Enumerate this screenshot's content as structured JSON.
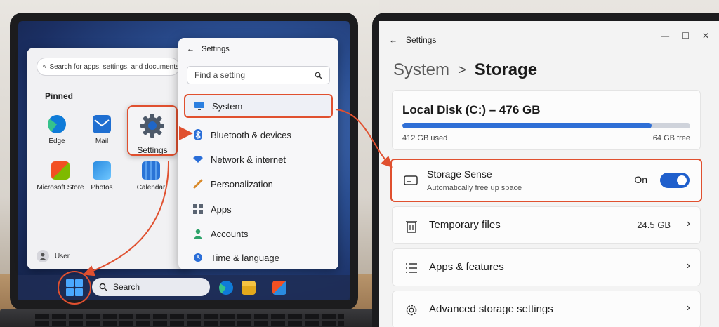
{
  "start_menu": {
    "search_placeholder": "Search for apps, settings, and documents",
    "pinned_label": "Pinned",
    "apps": [
      {
        "label": "Edge",
        "icon": "edge-icon"
      },
      {
        "label": "Mail",
        "icon": "mail-icon"
      },
      {
        "label": "Microsoft Store",
        "icon": "store-icon"
      },
      {
        "label": "Photos",
        "icon": "photos-icon"
      },
      {
        "label": "Calendar",
        "icon": "calendar-icon"
      }
    ],
    "settings_label": "Settings",
    "user_label": "User"
  },
  "settings_flyout": {
    "title": "Settings",
    "search_placeholder": "Find a setting",
    "items": [
      {
        "label": "System",
        "icon": "monitor-icon"
      },
      {
        "label": "Bluetooth & devices",
        "icon": "bluetooth-icon"
      },
      {
        "label": "Network & internet",
        "icon": "wifi-icon"
      },
      {
        "label": "Personalization",
        "icon": "brush-icon"
      },
      {
        "label": "Apps",
        "icon": "apps-icon"
      },
      {
        "label": "Accounts",
        "icon": "person-icon"
      },
      {
        "label": "Time & language",
        "icon": "clock-icon"
      }
    ]
  },
  "taskbar": {
    "search_label": "Search"
  },
  "settings_window": {
    "title": "Settings",
    "breadcrumb": {
      "parent": "System",
      "separator": ">",
      "current": "Storage"
    },
    "disk": {
      "title": "Local Disk (C:) – 476 GB",
      "used_label": "412 GB used",
      "free_label": "64 GB free",
      "used_fraction": 0.865
    },
    "storage_sense": {
      "title": "Storage Sense",
      "subtitle": "Automatically free up space",
      "state": "On"
    },
    "rows": [
      {
        "label": "Temporary files",
        "value": "24.5 GB",
        "icon": "trash-icon"
      },
      {
        "label": "Apps & features",
        "value": "",
        "icon": "list-icon"
      },
      {
        "label": "Advanced storage settings",
        "value": "",
        "icon": "gear-icon"
      }
    ]
  },
  "colors": {
    "highlight": "#e0502f",
    "accent": "#2f6fd6"
  }
}
